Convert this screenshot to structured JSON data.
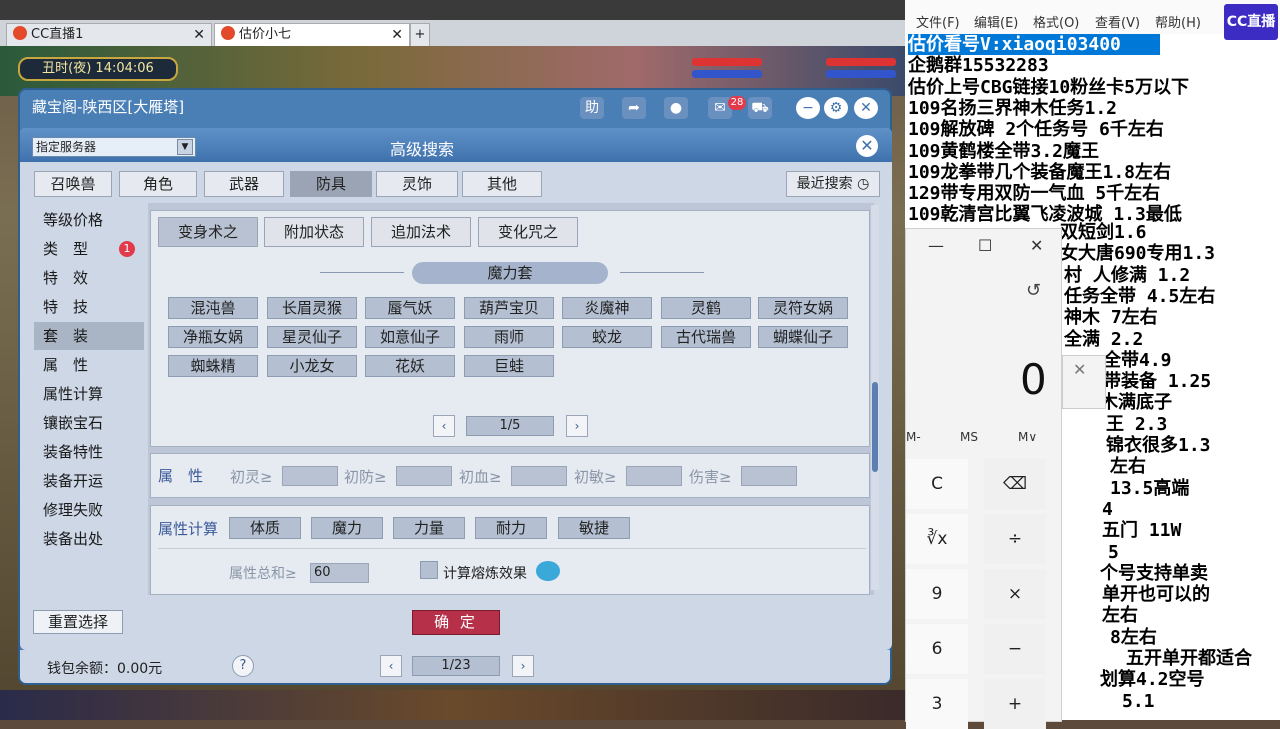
{
  "browser": {
    "tabs": [
      {
        "label": "CC直播1"
      },
      {
        "label": "估价小七"
      }
    ],
    "new_tab": "+"
  },
  "game": {
    "clock": "丑时(夜) 14:04:06"
  },
  "window": {
    "title": "藏宝阁-陕西区[大雁塔]",
    "help_label": "助",
    "cart_badge": "28"
  },
  "search": {
    "server_select": "指定服务器",
    "title": "高级搜索",
    "categories": [
      "召唤兽",
      "角色",
      "武器",
      "防具",
      "灵饰",
      "其他"
    ],
    "active_category": "防具",
    "recent_label": "最近搜索",
    "side_menu": [
      "等级价格",
      "类　型",
      "特　效",
      "特　技",
      "套　装",
      "属　性",
      "属性计算",
      "镶嵌宝石",
      "装备特性",
      "装备开运",
      "修理失败",
      "装备出处"
    ],
    "active_side": "套　装",
    "type_badge": "1",
    "set_tabs": [
      "变身术之",
      "附加状态",
      "追加法术",
      "变化咒之"
    ],
    "active_set_tab": "变身术之",
    "set_group_title": "魔力套",
    "set_items": [
      "混沌兽",
      "长眉灵猴",
      "蜃气妖",
      "葫芦宝贝",
      "炎魔神",
      "灵鹤",
      "灵符女娲",
      "净瓶女娲",
      "星灵仙子",
      "如意仙子",
      "雨师",
      "蛟龙",
      "古代瑞兽",
      "蝴蝶仙子",
      "蜘蛛精",
      "小龙女",
      "花妖",
      "巨蛙"
    ],
    "set_page": "1/5",
    "attr_label": "属　性",
    "attr_filters": [
      "初灵≥",
      "初防≥",
      "初血≥",
      "初敏≥",
      "伤害≥"
    ],
    "calc_label": "属性计算",
    "calc_attrs": [
      "体质",
      "魔力",
      "力量",
      "耐力",
      "敏捷"
    ],
    "sum_label": "属性总和≥",
    "sum_value": "60",
    "melt_label": "计算熔炼效果",
    "reset_label": "重置选择",
    "confirm_label": "确 定"
  },
  "footer": {
    "wallet": "钱包余额：0.00元",
    "help": "?",
    "page": "1/23"
  },
  "notepad": {
    "menu": [
      "文件(F)",
      "编辑(E)",
      "格式(O)",
      "查看(V)",
      "帮助(H)"
    ],
    "lines_full": [
      "估价看号V:xiaoqi03400",
      "企鹅群15532283",
      "估价上号CBG链接10粉丝卡5万以下",
      "109名扬三界神木任务1.2",
      "109解放碑 2个任务号 6千左右",
      "109黄鹤楼全带3.2魔王",
      "109龙拳带几个装备魔王1.8左右",
      "129带专用双防一气血 5千左右",
      "109乾清宫比翼飞凌波城 1.3最低"
    ],
    "lines_partial": [
      "双短剑1.6",
      "女大唐690专用1.3",
      "村 人修满 1.2",
      "任务全带 4.5左右",
      "神木 7左右",
      "全满 2.2",
      "全带4.9",
      "带装备 1.25",
      "木满底子",
      "王 2.3",
      "锦衣很多1.3",
      "左右",
      "13.5高端",
      "4",
      "五门 11W",
      "5",
      "个号支持单卖",
      "单开也可以的",
      "左右",
      "8左右",
      "五开单开都适合",
      "划算4.2空号",
      "5.1"
    ],
    "cc_logo": "CC直播"
  },
  "calculator": {
    "display": "0",
    "memory": [
      "M-",
      "MS",
      "M∨"
    ],
    "keys": [
      {
        "label": "C",
        "row": 0,
        "col": 0
      },
      {
        "label": "⌫",
        "row": 0,
        "col": 1
      },
      {
        "label": "∛x",
        "row": 1,
        "col": 0
      },
      {
        "label": "÷",
        "row": 1,
        "col": 1
      },
      {
        "label": "9",
        "row": 2,
        "col": 0
      },
      {
        "label": "×",
        "row": 2,
        "col": 1
      },
      {
        "label": "6",
        "row": 3,
        "col": 0
      },
      {
        "label": "−",
        "row": 3,
        "col": 1
      },
      {
        "label": "3",
        "row": 4,
        "col": 0
      },
      {
        "label": "+",
        "row": 4,
        "col": 1
      }
    ]
  }
}
